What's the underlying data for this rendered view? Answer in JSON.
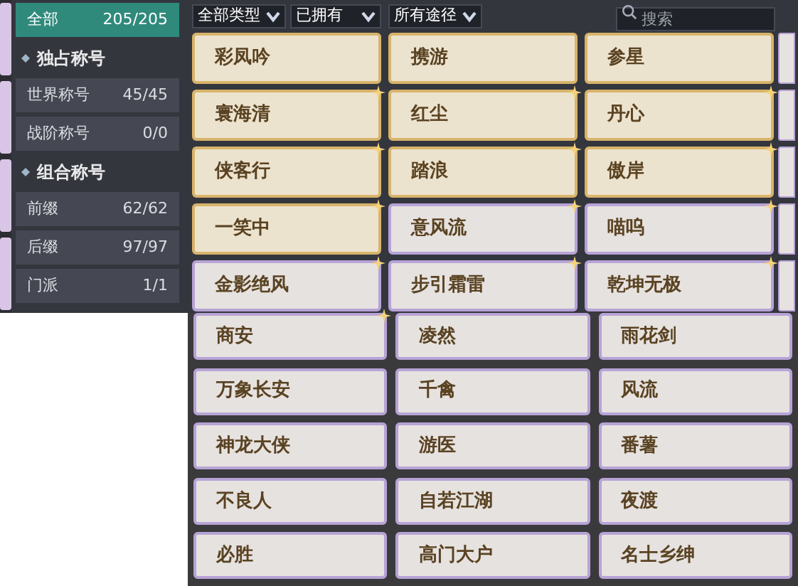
{
  "sidebar": {
    "items": [
      {
        "kind": "category",
        "label": "全部",
        "count": "205/205",
        "selected": true
      },
      {
        "kind": "group",
        "label": "独占称号"
      },
      {
        "kind": "category",
        "label": "世界称号",
        "count": "45/45",
        "selected": false
      },
      {
        "kind": "category",
        "label": "战阶称号",
        "count": "0/0",
        "selected": false
      },
      {
        "kind": "group",
        "label": "组合称号"
      },
      {
        "kind": "category",
        "label": "前缀",
        "count": "62/62",
        "selected": false
      },
      {
        "kind": "category",
        "label": "后缀",
        "count": "97/97",
        "selected": false
      },
      {
        "kind": "category",
        "label": "门派",
        "count": "1/1",
        "selected": false
      }
    ]
  },
  "filters": [
    {
      "label": "全部类型"
    },
    {
      "label": "已拥有"
    },
    {
      "label": "所有途径"
    }
  ],
  "search": {
    "placeholder": "搜索"
  },
  "titles": [
    {
      "label": "彩凤吟",
      "kind": "gold",
      "starred": false
    },
    {
      "label": "携游",
      "kind": "gold",
      "starred": false
    },
    {
      "label": "参星",
      "kind": "gold",
      "starred": false
    },
    {
      "label": "寰海清",
      "kind": "gold",
      "starred": true
    },
    {
      "label": "红尘",
      "kind": "gold",
      "starred": true
    },
    {
      "label": "丹心",
      "kind": "gold",
      "starred": true
    },
    {
      "label": "侠客行",
      "kind": "gold",
      "starred": true
    },
    {
      "label": "踏浪",
      "kind": "gold",
      "starred": true
    },
    {
      "label": "傲岸",
      "kind": "gold",
      "starred": true
    },
    {
      "label": "一笑中",
      "kind": "gold",
      "starred": true
    },
    {
      "label": "意风流",
      "kind": "purple",
      "starred": true
    },
    {
      "label": "喵呜",
      "kind": "purple",
      "starred": true
    },
    {
      "label": "金影绝风",
      "kind": "purple",
      "starred": true
    },
    {
      "label": "步引霜雷",
      "kind": "purple",
      "starred": true
    },
    {
      "label": "乾坤无极",
      "kind": "purple",
      "starred": true
    }
  ],
  "more_titles": [
    {
      "label": "商安",
      "kind": "purple",
      "starred": true
    },
    {
      "label": "凌然",
      "kind": "purple",
      "starred": false
    },
    {
      "label": "雨花剑",
      "kind": "purple",
      "starred": false
    },
    {
      "label": "万象长安",
      "kind": "purple",
      "starred": false
    },
    {
      "label": "千禽",
      "kind": "purple",
      "starred": false
    },
    {
      "label": "风流",
      "kind": "purple",
      "starred": false
    },
    {
      "label": "神龙大侠",
      "kind": "purple",
      "starred": false
    },
    {
      "label": "游医",
      "kind": "purple",
      "starred": false
    },
    {
      "label": "番薯",
      "kind": "purple",
      "starred": false
    },
    {
      "label": "不良人",
      "kind": "purple",
      "starred": false
    },
    {
      "label": "自若江湖",
      "kind": "purple",
      "starred": false
    },
    {
      "label": "夜渡",
      "kind": "purple",
      "starred": false
    },
    {
      "label": "必胜",
      "kind": "purple",
      "starred": false
    },
    {
      "label": "高门大户",
      "kind": "purple",
      "starred": false
    },
    {
      "label": "名士乡绅",
      "kind": "purple",
      "starred": false
    }
  ]
}
